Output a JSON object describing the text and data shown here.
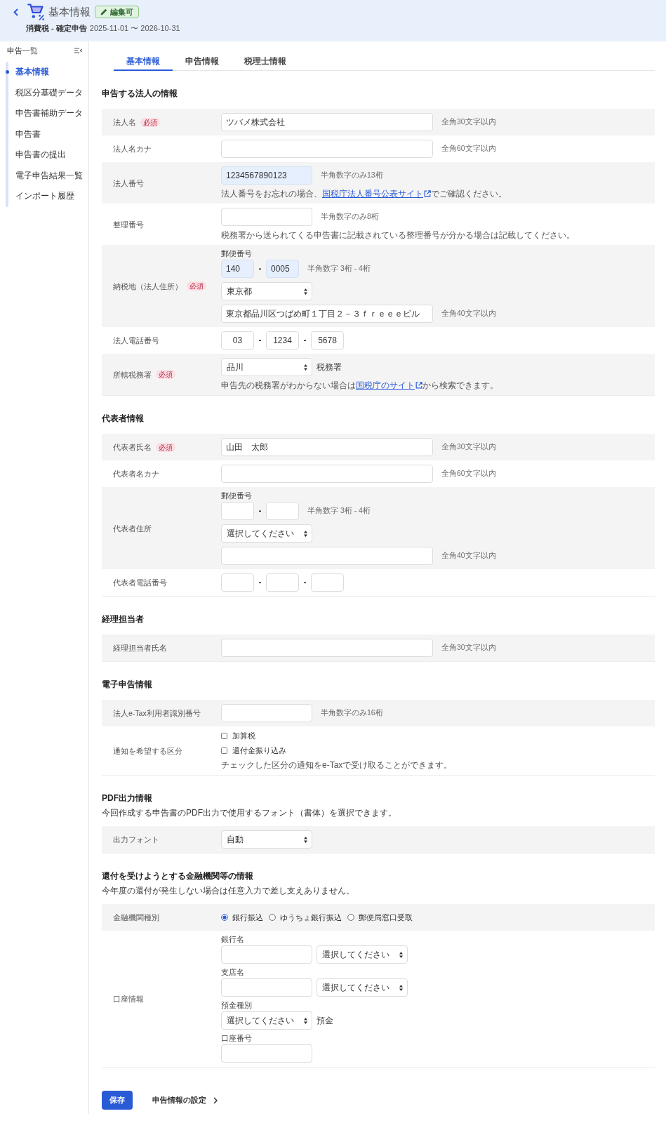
{
  "header": {
    "title": "基本情報",
    "badge": "編集可",
    "return_type": "消費税 - 確定申告",
    "period": "2025-11-01 〜 2026-10-31"
  },
  "sidebar": {
    "title": "申告一覧",
    "items": [
      {
        "label": "基本情報",
        "selected": true
      },
      {
        "label": "税区分基礎データ",
        "selected": false
      },
      {
        "label": "申告書補助データ",
        "selected": false
      },
      {
        "label": "申告書",
        "selected": false
      },
      {
        "label": "申告書の提出",
        "selected": false
      },
      {
        "label": "電子申告結果一覧",
        "selected": false
      },
      {
        "label": "インポート履歴",
        "selected": false
      }
    ]
  },
  "tabs": [
    {
      "label": "基本情報",
      "selected": true
    },
    {
      "label": "申告情報",
      "selected": false
    },
    {
      "label": "税理士情報",
      "selected": false
    }
  ],
  "sections": [
    {
      "title": "申告する法人の情報",
      "rows": [
        {
          "label": "法人名",
          "badge": "必須",
          "lines": [
            [
              {
                "kind": "wide_field",
                "value": "ツバメ株式会社",
                "autofilled": false
              },
              {
                "kind": "hint",
                "text": "全角30文字以内"
              }
            ]
          ]
        },
        {
          "label": "法人名カナ",
          "lines": [
            [
              {
                "kind": "wide_field",
                "autofilled": false
              },
              {
                "kind": "hint",
                "text": "全角60文字以内"
              }
            ]
          ]
        },
        {
          "label": "法人番号",
          "lines": [
            [
              {
                "kind": "field",
                "value": "1234567890123",
                "autofilled": true
              },
              {
                "kind": "hint",
                "text": "半角数字のみ13桁"
              }
            ],
            [
              {
                "kind": "note",
                "text": "法人番号をお忘れの場合、",
                "link": "国税庁法人番号公表サイト",
                "after": "でご確認ください。"
              }
            ]
          ]
        },
        {
          "label": "整理番号",
          "lines": [
            [
              {
                "kind": "field",
                "autofilled": false
              },
              {
                "kind": "hint",
                "text": "半角数字のみ8桁"
              }
            ],
            [
              {
                "kind": "note",
                "text": "税務署から送られてくる申告書に記載されている整理番号が分かる場合は記載してください。"
              }
            ]
          ]
        },
        {
          "label": "納税地（法人住所）",
          "badge": "必須",
          "lines": [
            [
              {
                "kind": "caption",
                "text": "郵便番号"
              }
            ],
            [
              {
                "kind": "postal_field",
                "value": "140",
                "autofilled": true
              },
              {
                "kind": "dash",
                "text": "-"
              },
              {
                "kind": "postal_field",
                "value": "0005",
                "autofilled": true
              },
              {
                "kind": "hint",
                "text": "半角数字 3桁 - 4桁"
              }
            ],
            [
              {
                "kind": "select",
                "value": "東京都"
              }
            ],
            [
              {
                "kind": "wide_field",
                "value": "東京都品川区つばめ町１丁目２－３ｆｒｅｅｅビル",
                "autofilled": false
              },
              {
                "kind": "hint",
                "text": "全角40文字以内"
              }
            ]
          ]
        },
        {
          "label": "法人電話番号",
          "lines": [
            [
              {
                "kind": "phone_field",
                "value": "03",
                "autofilled": false
              },
              {
                "kind": "dash",
                "text": "-"
              },
              {
                "kind": "phone_field",
                "value": "1234",
                "autofilled": false
              },
              {
                "kind": "dash",
                "text": "-"
              },
              {
                "kind": "phone_field",
                "value": "5678",
                "autofilled": false
              }
            ]
          ]
        },
        {
          "label": "所轄税務署",
          "badge": "必須",
          "lines": [
            [
              {
                "kind": "select",
                "value": "品川"
              },
              {
                "kind": "unit",
                "text": "税務署"
              }
            ],
            [
              {
                "kind": "note",
                "text": "申告先の税務署がわからない場合は",
                "link": "国税庁のサイト",
                "after": "から検索できます。"
              }
            ]
          ]
        }
      ]
    },
    {
      "title": "代表者情報",
      "rows": [
        {
          "label": "代表者氏名",
          "badge": "必須",
          "lines": [
            [
              {
                "kind": "wide_field",
                "value": "山田　太郎",
                "autofilled": false
              },
              {
                "kind": "hint",
                "text": "全角30文字以内"
              }
            ]
          ]
        },
        {
          "label": "代表者名カナ",
          "lines": [
            [
              {
                "kind": "wide_field",
                "autofilled": false
              },
              {
                "kind": "hint",
                "text": "全角60文字以内"
              }
            ]
          ]
        },
        {
          "label": "代表者住所",
          "lines": [
            [
              {
                "kind": "caption",
                "text": "郵便番号"
              }
            ],
            [
              {
                "kind": "postal_field",
                "autofilled": false
              },
              {
                "kind": "dash",
                "text": "-"
              },
              {
                "kind": "postal_field",
                "autofilled": false
              },
              {
                "kind": "hint",
                "text": "半角数字 3桁 - 4桁"
              }
            ],
            [
              {
                "kind": "select",
                "value": "選択してください"
              }
            ],
            [
              {
                "kind": "wide_field",
                "autofilled": false
              },
              {
                "kind": "hint",
                "text": "全角40文字以内"
              }
            ]
          ]
        },
        {
          "label": "代表者電話番号",
          "lines": [
            [
              {
                "kind": "phone_field",
                "autofilled": false
              },
              {
                "kind": "dash",
                "text": "-"
              },
              {
                "kind": "phone_field",
                "autofilled": false
              },
              {
                "kind": "dash",
                "text": "-"
              },
              {
                "kind": "phone_field",
                "autofilled": false
              }
            ]
          ]
        }
      ]
    },
    {
      "title": "経理担当者",
      "rows": [
        {
          "label": "経理担当者氏名",
          "lines": [
            [
              {
                "kind": "wide_field",
                "autofilled": false
              },
              {
                "kind": "hint",
                "text": "全角30文字以内"
              }
            ]
          ]
        }
      ]
    },
    {
      "title": "電子申告情報",
      "rows": [
        {
          "label": "法人e-Tax利用者識別番号",
          "lines": [
            [
              {
                "kind": "field",
                "autofilled": false
              },
              {
                "kind": "hint",
                "text": "半角数字のみ16桁"
              }
            ]
          ]
        },
        {
          "label": "通知を希望する区分",
          "lines": [
            [
              {
                "kind": "checkbox",
                "label": "加算税",
                "checked": false
              }
            ],
            [
              {
                "kind": "checkbox",
                "label": "還付金振り込み",
                "checked": false
              }
            ],
            [
              {
                "kind": "note",
                "text": "チェックした区分の通知をe-Taxで受け取ることができます。"
              }
            ]
          ]
        }
      ]
    },
    {
      "title": "PDF出力情報",
      "description": "今回作成する申告書のPDF出力で使用するフォント（書体）を選択できます。",
      "rows": [
        {
          "label": "出力フォント",
          "lines": [
            [
              {
                "kind": "select",
                "value": "自動"
              }
            ]
          ]
        }
      ]
    },
    {
      "title": "還付を受けようとする金融機関等の情報",
      "description": "今年度の還付が発生しない場合は任意入力で差し支えありません。",
      "rows": [
        {
          "label": "金融機関種別",
          "lines": [
            [
              {
                "kind": "radio",
                "label": "銀行振込",
                "selected": true
              },
              {
                "kind": "radio",
                "label": "ゆうちょ銀行振込",
                "selected": false
              },
              {
                "kind": "radio",
                "label": "郵便局窓口受取",
                "selected": false
              }
            ]
          ]
        },
        {
          "label": "口座情報",
          "lines": [
            [
              {
                "kind": "caption",
                "text": "銀行名"
              }
            ],
            [
              {
                "kind": "field",
                "autofilled": false
              },
              {
                "kind": "select",
                "value": "選択してください"
              }
            ],
            [
              {
                "kind": "caption",
                "text": "支店名"
              }
            ],
            [
              {
                "kind": "field",
                "autofilled": false
              },
              {
                "kind": "select",
                "value": "選択してください"
              }
            ],
            [
              {
                "kind": "caption",
                "text": "預金種別"
              }
            ],
            [
              {
                "kind": "select",
                "value": "選択してください"
              },
              {
                "kind": "unit",
                "text": "預金"
              }
            ],
            [
              {
                "kind": "caption",
                "text": "口座番号"
              }
            ],
            [
              {
                "kind": "field",
                "autofilled": false
              }
            ]
          ]
        }
      ]
    }
  ],
  "actions": {
    "save": "保存",
    "next": "申告情報の設定"
  }
}
